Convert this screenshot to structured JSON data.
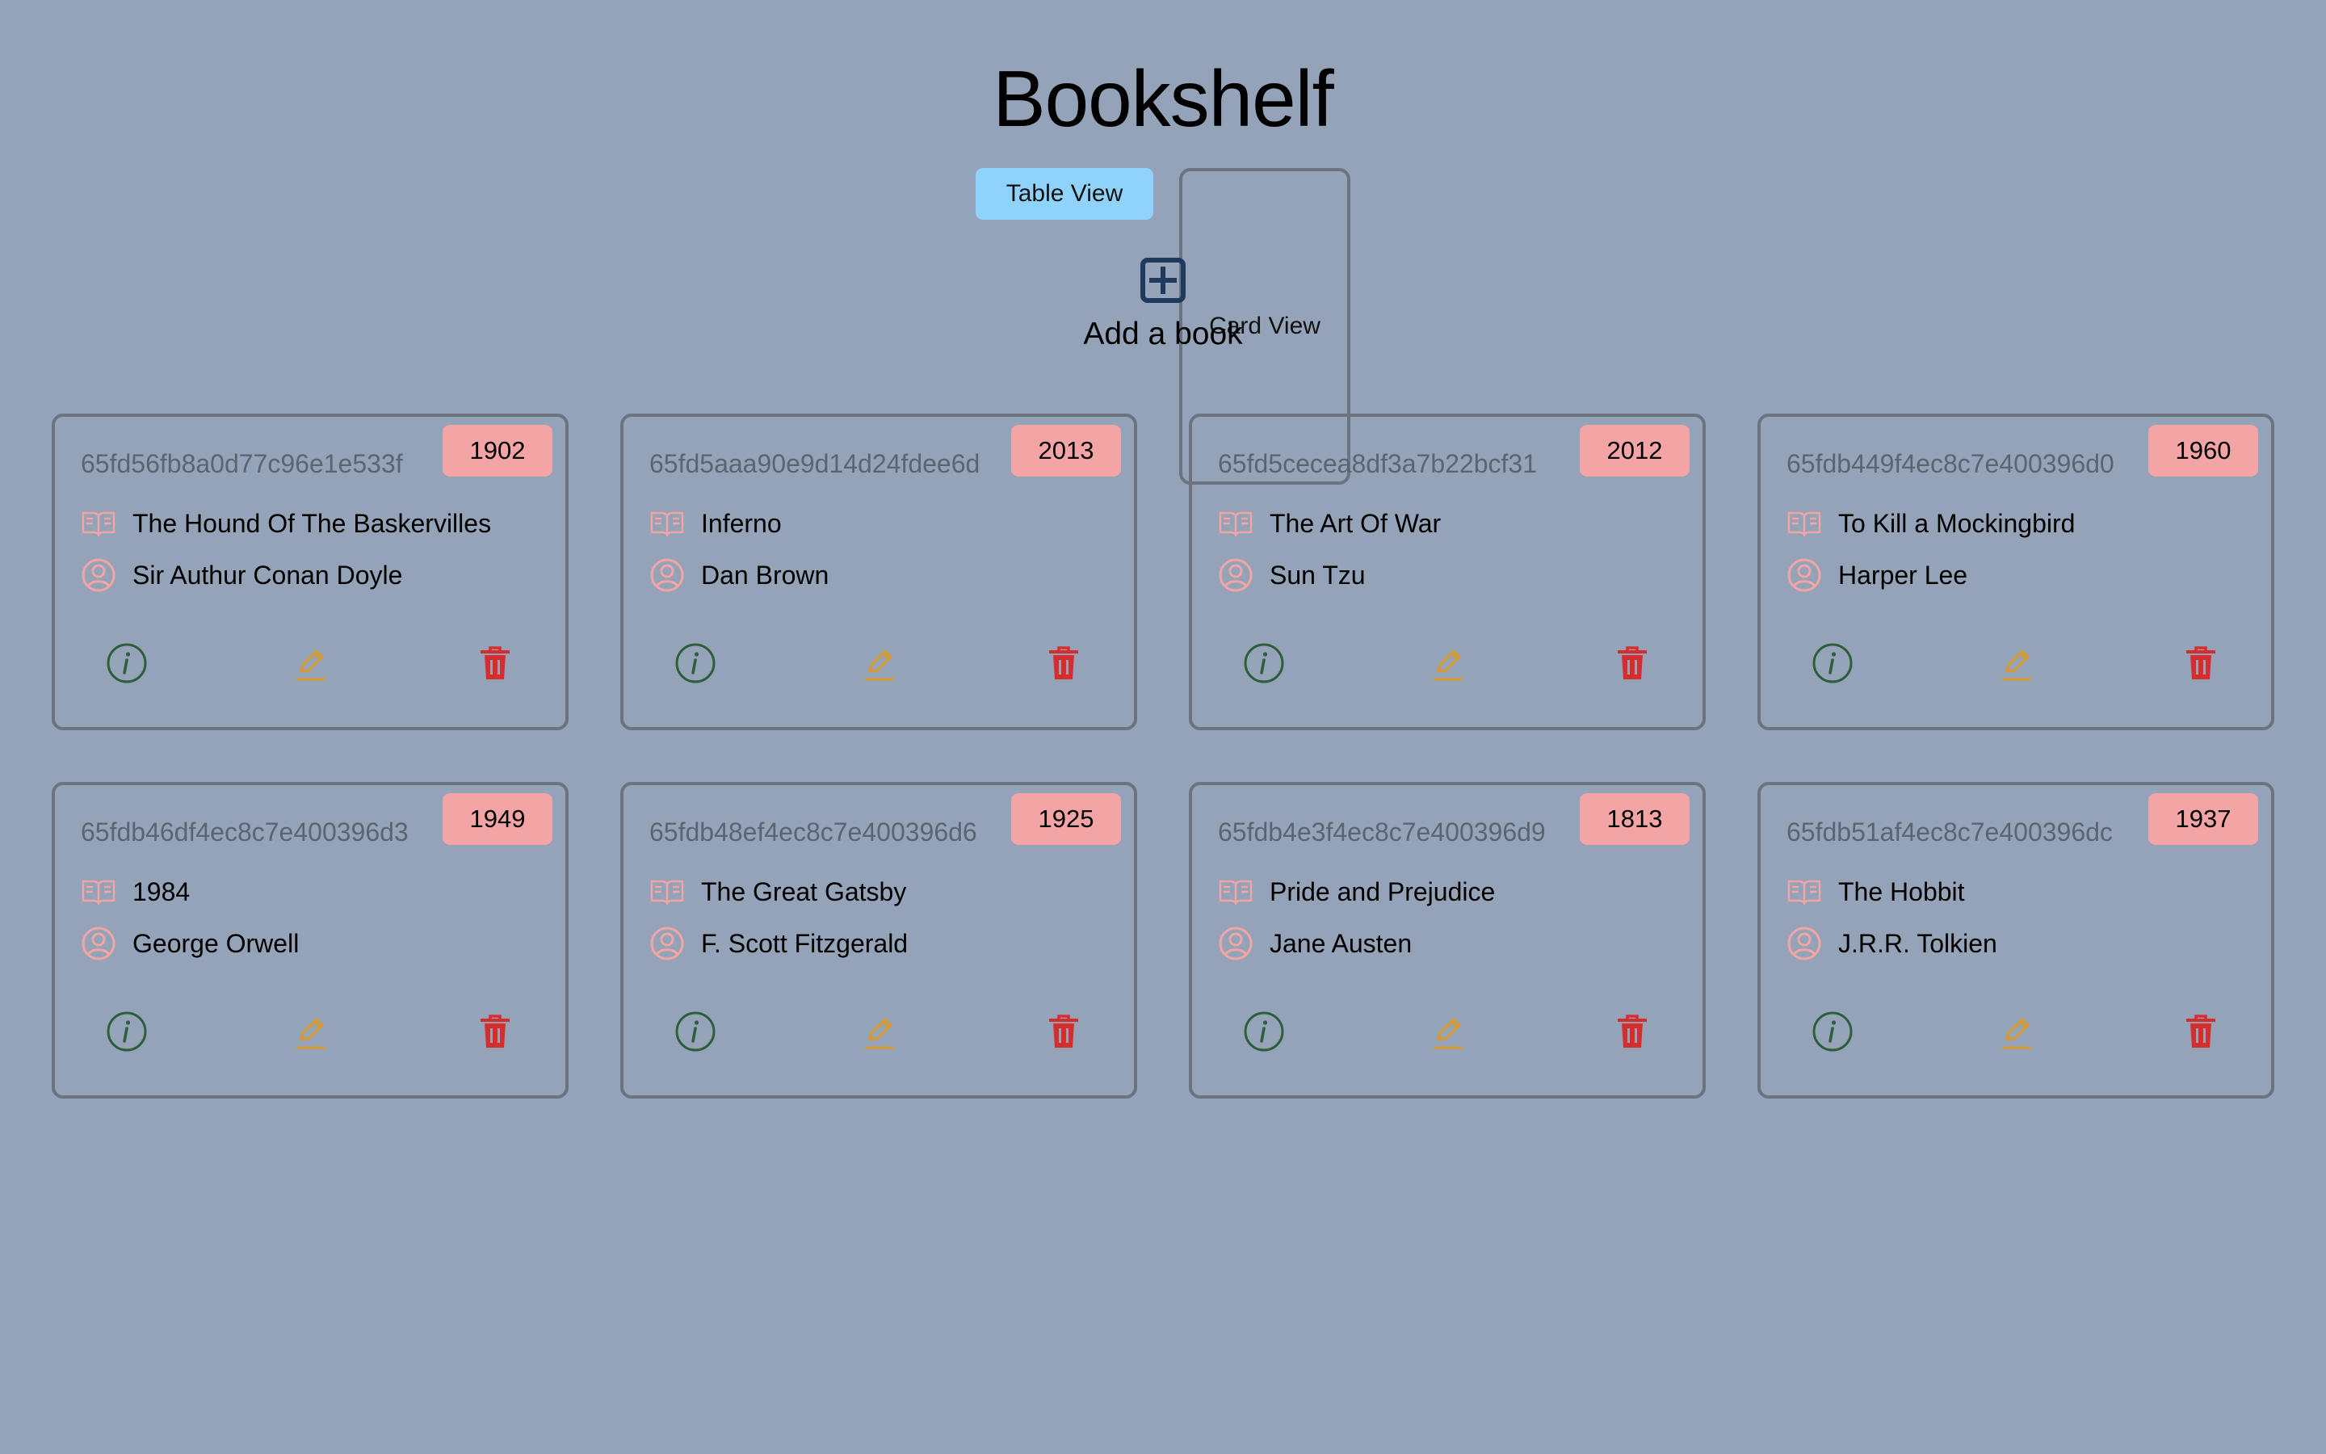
{
  "header": {
    "title": "Bookshelf"
  },
  "view_toggle": {
    "table_label": "Table View",
    "card_label": "Card View"
  },
  "add_book": {
    "label": "Add a book",
    "icon": "plus-square-icon"
  },
  "colors": {
    "background": "#94a3b8",
    "button": "#8fd3fb",
    "badge": "#f3a5a5",
    "pink_icon": "#f3a5a5",
    "info_icon": "#2f5f3a",
    "edit_icon": "#d79a2b",
    "delete_icon": "#d62e2e"
  },
  "books": [
    {
      "id": "65fd56fb8a0d77c96e1e533f",
      "year": "1902",
      "title": "The Hound Of The Baskervilles",
      "author": "Sir Authur Conan Doyle"
    },
    {
      "id": "65fd5aaa90e9d14d24fdee6d",
      "year": "2013",
      "title": "Inferno",
      "author": "Dan Brown"
    },
    {
      "id": "65fd5cecea8df3a7b22bcf31",
      "year": "2012",
      "title": "The Art Of War",
      "author": "Sun Tzu"
    },
    {
      "id": "65fdb449f4ec8c7e400396d0",
      "year": "1960",
      "title": "To Kill a Mockingbird",
      "author": "Harper Lee"
    },
    {
      "id": "65fdb46df4ec8c7e400396d3",
      "year": "1949",
      "title": "1984",
      "author": "George Orwell"
    },
    {
      "id": "65fdb48ef4ec8c7e400396d6",
      "year": "1925",
      "title": "The Great Gatsby",
      "author": "F. Scott Fitzgerald"
    },
    {
      "id": "65fdb4e3f4ec8c7e400396d9",
      "year": "1813",
      "title": "Pride and Prejudice",
      "author": "Jane Austen"
    },
    {
      "id": "65fdb51af4ec8c7e400396dc",
      "year": "1937",
      "title": "The Hobbit",
      "author": "J.R.R. Tolkien"
    }
  ]
}
